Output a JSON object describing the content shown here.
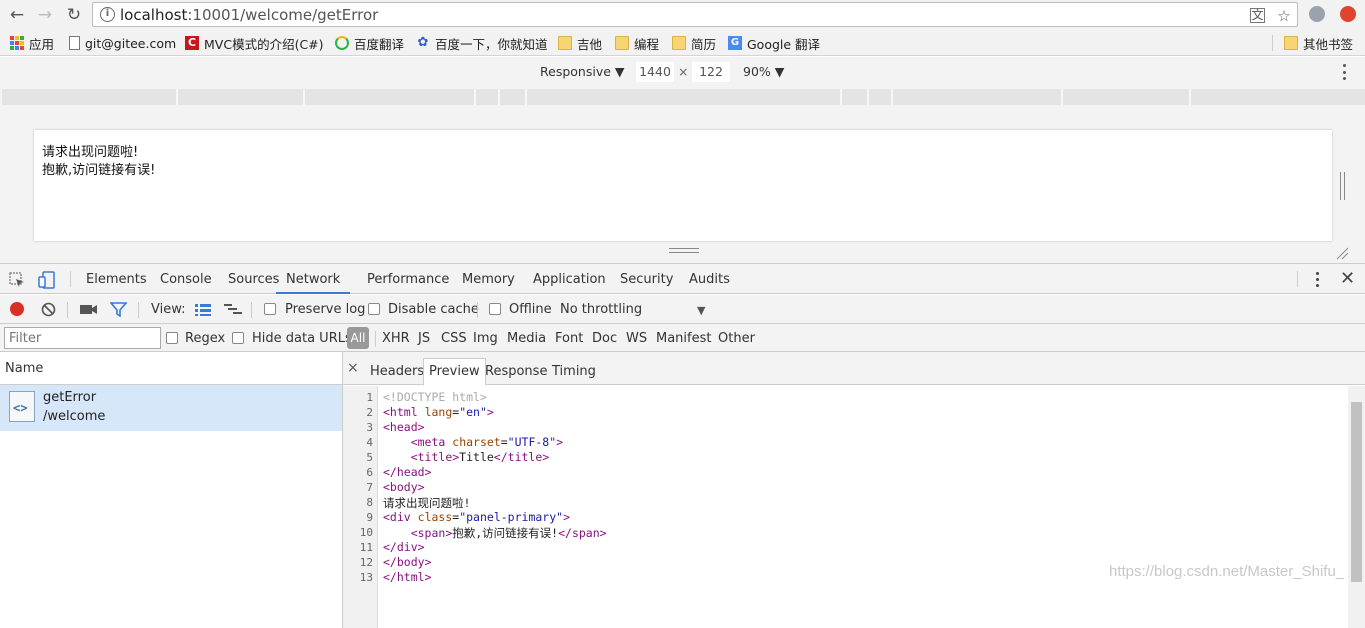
{
  "browser": {
    "url_host": "localhost",
    "url_rest": ":10001/welcome/getError",
    "bookmarks": [
      {
        "label": "应用",
        "icon": "apps-grid-icon"
      },
      {
        "label": "git@gitee.com",
        "icon": "page-icon"
      },
      {
        "label": "MVC模式的介绍(C#)",
        "icon": "csdn-icon"
      },
      {
        "label": "百度翻译",
        "icon": "baidu-translate-icon"
      },
      {
        "label": "百度一下，你就知道",
        "icon": "baidu-paw-icon"
      },
      {
        "label": "吉他",
        "icon": "folder-icon"
      },
      {
        "label": "编程",
        "icon": "folder-icon"
      },
      {
        "label": "简历",
        "icon": "folder-icon"
      },
      {
        "label": "Google 翻译",
        "icon": "google-translate-icon"
      },
      {
        "label": "其他书签",
        "icon": "folder-icon"
      }
    ]
  },
  "device_toolbar": {
    "mode": "Responsive",
    "width": "1440",
    "times": "×",
    "height": "122",
    "zoom": "90%"
  },
  "viewport": {
    "line1": "请求出现问题啦!",
    "line2": "抱歉,访问链接有误!"
  },
  "devtools": {
    "tabs": [
      "Elements",
      "Console",
      "Sources",
      "Network",
      "Performance",
      "Memory",
      "Application",
      "Security",
      "Audits"
    ],
    "active_tab": "Network",
    "network_toolbar": {
      "view_label": "View:",
      "preserve_log": "Preserve log",
      "disable_cache": "Disable cache",
      "offline": "Offline",
      "throttling": "No throttling"
    },
    "filter": {
      "placeholder": "Filter",
      "regex": "Regex",
      "hide_data_urls": "Hide data URLs",
      "types": [
        "All",
        "XHR",
        "JS",
        "CSS",
        "Img",
        "Media",
        "Font",
        "Doc",
        "WS",
        "Manifest",
        "Other"
      ]
    },
    "requests": {
      "header": "Name",
      "rows": [
        {
          "name": "getError",
          "path": "/welcome"
        }
      ]
    },
    "detail": {
      "close": "×",
      "tabs": [
        "Headers",
        "Preview",
        "Response",
        "Timing"
      ],
      "active_tab": "Preview",
      "line_numbers": [
        "1",
        "2",
        "3",
        "4",
        "5",
        "6",
        "7",
        "8",
        "9",
        "10",
        "11",
        "12",
        "13"
      ]
    }
  },
  "watermark": "https://blog.csdn.net/Master_Shifu_",
  "colors": {
    "accent": "#3879d9",
    "record": "#d93025",
    "selected_row": "#d7e7fa"
  }
}
